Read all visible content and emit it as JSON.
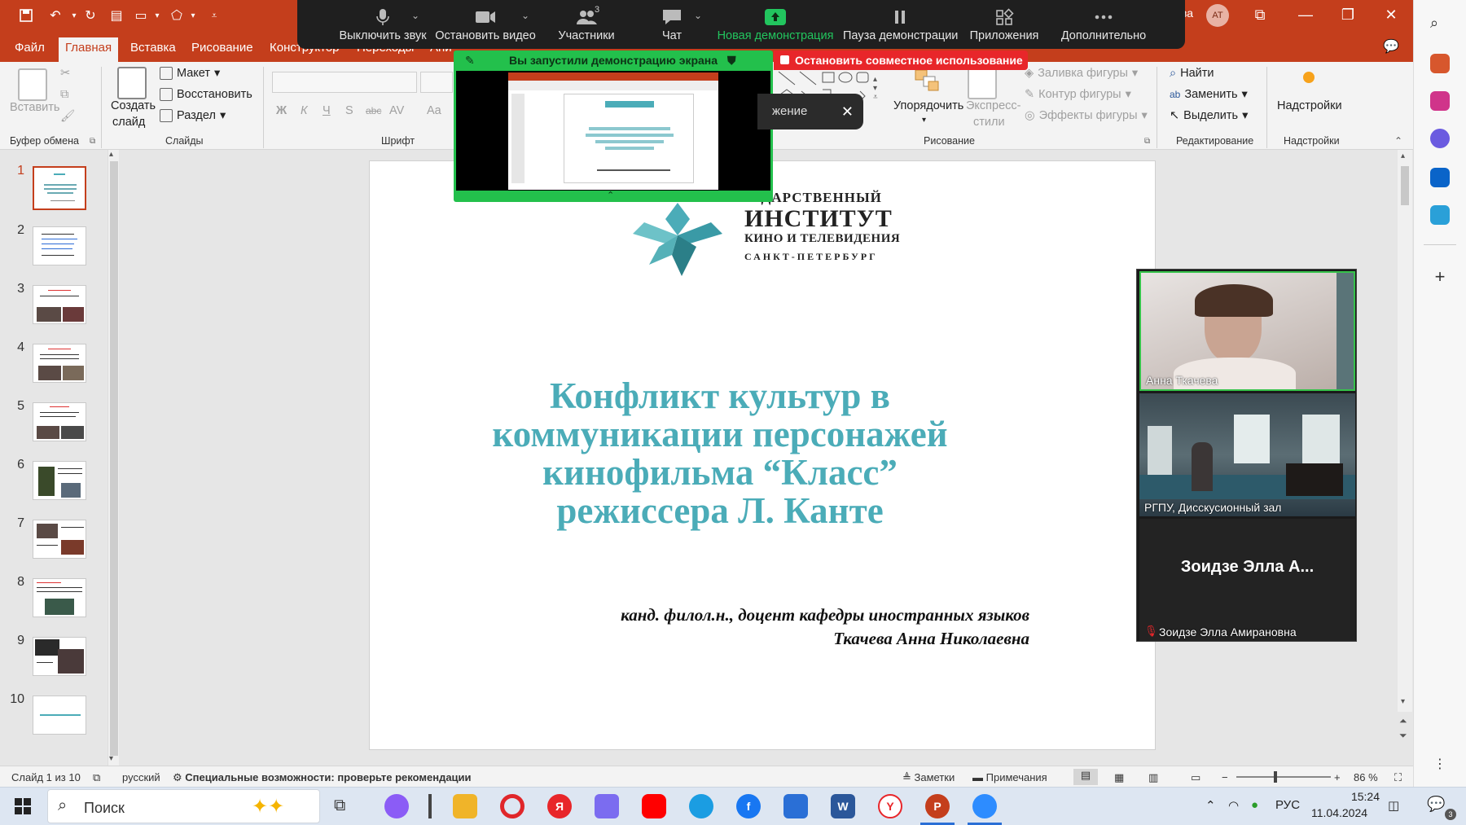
{
  "app": {
    "tabs": [
      "Файл",
      "Главная",
      "Вставка",
      "Рисование",
      "Конструктор",
      "Переходы",
      "Ани"
    ],
    "active_tab": "Главная",
    "user_fragment": "ва",
    "user_initials": "АТ"
  },
  "ribbon": {
    "clipboard": {
      "paste": "Вставить",
      "label": "Буфер обмена"
    },
    "slides": {
      "new_slide_line1": "Создать",
      "new_slide_line2": "слайд",
      "layout": "Макет",
      "reset": "Восстановить",
      "section": "Раздел",
      "label": "Слайды"
    },
    "font": {
      "label": "Шрифт",
      "bold": "Ж",
      "italic": "К",
      "underline": "Ч",
      "shadow": "S",
      "strike": "abc",
      "spacing": "AV",
      "case": "Aa"
    },
    "drawing": {
      "arrange": "Упорядочить",
      "quick_styles_line1": "Экспресс-",
      "quick_styles_line2": "стили",
      "fill": "Заливка фигуры",
      "outline": "Контур фигуры",
      "effects": "Эффекты фигуры",
      "label": "Рисование"
    },
    "editing": {
      "find": "Найти",
      "replace": "Заменить",
      "select": "Выделить",
      "label": "Редактирование"
    },
    "addins": {
      "button": "Надстройки",
      "label": "Надстройки"
    }
  },
  "zoom": {
    "toolbar": [
      {
        "label": "Выключить звук",
        "icon": "microphone-icon"
      },
      {
        "label": "Остановить видео",
        "icon": "video-camera-icon"
      },
      {
        "label": "Участники",
        "icon": "participants-icon",
        "count": "3"
      },
      {
        "label": "Чат",
        "icon": "chat-icon"
      },
      {
        "label": "Новая демонстрация",
        "icon": "share-screen-icon"
      },
      {
        "label": "Пауза демонстрации",
        "icon": "pause-icon"
      },
      {
        "label": "Приложения",
        "icon": "apps-icon"
      },
      {
        "label": "Дополнительно",
        "icon": "more-icon"
      }
    ],
    "share_banner": "Вы запустили демонстрацию экрана",
    "stop_share": "Остановить совместное использование",
    "tooltip_fragment": "жение",
    "participants": [
      {
        "name": "Анна Ткачева"
      },
      {
        "name": "РГПУ, Дисскусионный зал"
      },
      {
        "name": "Зоидзе Элла Амирановна",
        "display": "Зоидзе Элла А..."
      }
    ],
    "accent": "#23c04c",
    "stop_color": "#e8262a"
  },
  "thumbnails": {
    "numbers": [
      "1",
      "2",
      "3",
      "4",
      "5",
      "6",
      "7",
      "8",
      "9",
      "10"
    ],
    "selected": "1"
  },
  "slide": {
    "title": "Конфликт культур в коммуникации персонажей кинофильма “Класс” режиссера Л. Канте",
    "author_line1": "канд. филол.н., доцент кафедры иностранных языков",
    "author_line2": "Ткачева Анна Николаевна",
    "logo_line1": "ГОСУДАРСТВЕННЫЙ",
    "logo_line2": "ИНСТИТУТ",
    "logo_line3": "КИНО И ТЕЛЕВИДЕНИЯ",
    "logo_line4": "САНКТ-ПЕТЕРБУРГ",
    "title_color": "#4bacb8"
  },
  "statusbar": {
    "slide_info": "Слайд 1 из 10",
    "language": "русский",
    "accessibility": "Специальные возможности: проверьте рекомендации",
    "notes": "Заметки",
    "comments": "Примечания",
    "zoom": "86 %"
  },
  "taskbar": {
    "search": "Поиск",
    "lang": "РУС",
    "time": "15:24",
    "date": "11.04.2024",
    "notif_count": "3"
  }
}
